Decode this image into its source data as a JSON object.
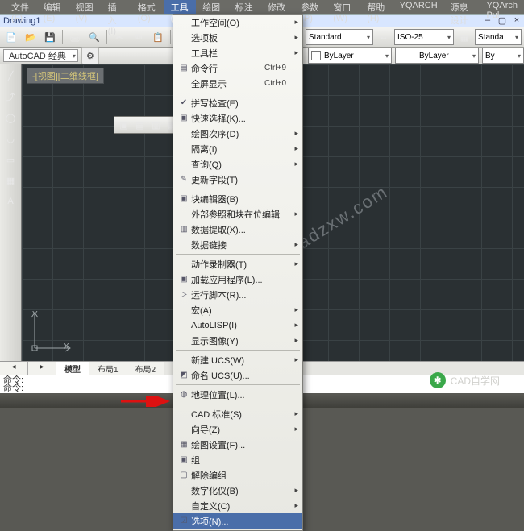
{
  "menubar": {
    "items": [
      {
        "label": "文件(F)"
      },
      {
        "label": "编辑(E)"
      },
      {
        "label": "视图(V)"
      },
      {
        "label": "插入(I)"
      },
      {
        "label": "格式(O)"
      },
      {
        "label": "工具(T)",
        "active": true
      },
      {
        "label": "绘图(D)"
      },
      {
        "label": "标注(N)"
      },
      {
        "label": "修改(M)"
      },
      {
        "label": "参数(P)"
      },
      {
        "label": "窗口(W)"
      },
      {
        "label": "帮助(H)"
      },
      {
        "label": "YQARCH"
      },
      {
        "label": "源泉设计"
      },
      {
        "label": "YQArch Pul"
      }
    ]
  },
  "doc": {
    "title": "Drawing1",
    "min": "–",
    "max": "▢",
    "close": "×"
  },
  "ws": {
    "label": "AutoCAD 经典"
  },
  "props": {
    "color_dd": "ByLayer",
    "lt_dd": "ByLayer",
    "lw_dd": "By",
    "style1": "Standard",
    "style2": "ISO-25",
    "style3": "Standa"
  },
  "annot": "-[视图][二维线框]",
  "axes": {
    "x": "X",
    "y": "Y"
  },
  "tabs": {
    "items": [
      "模型",
      "布局1",
      "布局2"
    ],
    "nav_l": "◂",
    "nav_r": "▸"
  },
  "cmd": {
    "prompt1": "命令:",
    "prompt2": "命令:"
  },
  "menu": {
    "items": [
      {
        "t": "工作空间(O)",
        "sub": true
      },
      {
        "t": "选项板",
        "sub": true
      },
      {
        "t": "工具栏",
        "sub": true
      },
      {
        "t": "命令行",
        "sc": "Ctrl+9",
        "ic": "▤"
      },
      {
        "t": "全屏显示",
        "sc": "Ctrl+0"
      },
      {
        "sep": true
      },
      {
        "t": "拼写检查(E)",
        "ic": "✔"
      },
      {
        "t": "快速选择(K)...",
        "ic": "▣"
      },
      {
        "t": "绘图次序(D)",
        "sub": true
      },
      {
        "t": "隔离(I)",
        "sub": true
      },
      {
        "t": "查询(Q)",
        "sub": true
      },
      {
        "t": "更新字段(T)",
        "ic": "✎"
      },
      {
        "sep": true
      },
      {
        "t": "块编辑器(B)",
        "ic": "▣"
      },
      {
        "t": "外部参照和块在位编辑",
        "sub": true
      },
      {
        "t": "数据提取(X)...",
        "ic": "▥"
      },
      {
        "t": "数据链接",
        "sub": true
      },
      {
        "sep": true
      },
      {
        "t": "动作录制器(T)",
        "sub": true
      },
      {
        "t": "加载应用程序(L)...",
        "ic": "▣"
      },
      {
        "t": "运行脚本(R)...",
        "ic": "▷"
      },
      {
        "t": "宏(A)",
        "sub": true
      },
      {
        "t": "AutoLISP(I)",
        "sub": true
      },
      {
        "t": "显示图像(Y)",
        "sub": true
      },
      {
        "sep": true
      },
      {
        "t": "新建 UCS(W)",
        "sub": true
      },
      {
        "t": "命名 UCS(U)...",
        "ic": "◩"
      },
      {
        "sep": true
      },
      {
        "t": "地理位置(L)...",
        "ic": "◍"
      },
      {
        "sep": true
      },
      {
        "t": "CAD 标准(S)",
        "sub": true
      },
      {
        "t": "向导(Z)",
        "sub": true
      },
      {
        "t": "绘图设置(F)...",
        "ic": "▦"
      },
      {
        "t": "组",
        "ic": "▣"
      },
      {
        "t": "解除编组",
        "ic": "▢"
      },
      {
        "t": "数字化仪(B)",
        "sub": true
      },
      {
        "t": "自定义(C)",
        "sub": true
      },
      {
        "t": "选项(N)...",
        "ic": "☑",
        "hl": true
      }
    ]
  },
  "watermark": "cadzxw.com",
  "wx": "CAD自学网",
  "iconcolors": {
    "a": "#3a78c8",
    "b": "#c84a3a",
    "c": "#3aa84a",
    "d": "#c8a23a"
  }
}
